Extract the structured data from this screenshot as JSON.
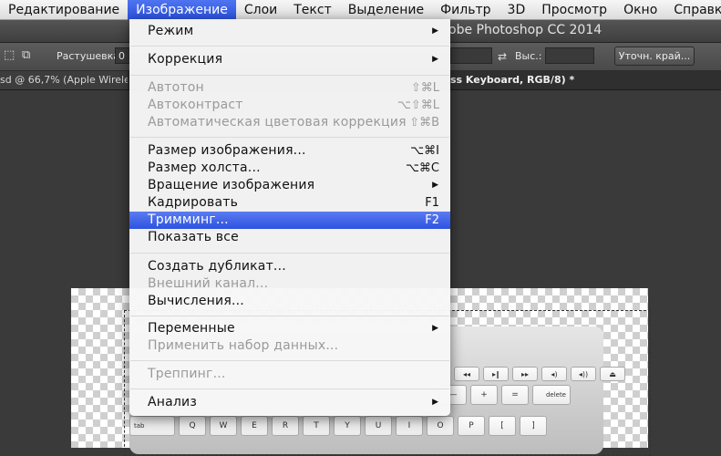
{
  "menubar": {
    "items": [
      "Редактирование",
      "Изображение",
      "Слои",
      "Текст",
      "Выделение",
      "Фильтр",
      "3D",
      "Просмотр",
      "Окно",
      "Справка"
    ]
  },
  "window": {
    "title": "obe Photoshop CC 2014"
  },
  "options_bar": {
    "feather_label": "Растушевка:",
    "feather_value": "0",
    "height_label": "Выс.:",
    "refine_edge_button": "Уточн. край..."
  },
  "tabs": [
    "sd @ 66,7% (Apple Wirele",
    "ss Keyboard, RGB/8) *"
  ],
  "keyboard": {
    "tab_key": "tab",
    "delete_key": "delete",
    "letter_keys": [
      "Q",
      "W",
      "E",
      "R",
      "T",
      "Y",
      "U",
      "I",
      "O",
      "P",
      "[",
      "]"
    ],
    "number_keys_right": [
      "-",
      "=",
      "delete"
    ]
  },
  "menu": {
    "items": [
      {
        "label": "Режим",
        "shortcut": "",
        "submenu": true,
        "disabled": false
      },
      {
        "label": "Коррекция",
        "shortcut": "",
        "submenu": true,
        "disabled": false
      },
      {
        "label": "Автотон",
        "shortcut": "⇧⌘L",
        "submenu": false,
        "disabled": true
      },
      {
        "label": "Автоконтраст",
        "shortcut": "⌥⇧⌘L",
        "submenu": false,
        "disabled": true
      },
      {
        "label": "Автоматическая цветовая коррекция",
        "shortcut": "⇧⌘B",
        "submenu": false,
        "disabled": true
      },
      {
        "label": "Размер изображения...",
        "shortcut": "⌥⌘I",
        "submenu": false,
        "disabled": false
      },
      {
        "label": "Размер холста...",
        "shortcut": "⌥⌘C",
        "submenu": false,
        "disabled": false
      },
      {
        "label": "Вращение изображения",
        "shortcut": "",
        "submenu": true,
        "disabled": false
      },
      {
        "label": "Кадрировать",
        "shortcut": "F1",
        "submenu": false,
        "disabled": false
      },
      {
        "label": "Тримминг...",
        "shortcut": "F2",
        "submenu": false,
        "disabled": false,
        "highlighted": true
      },
      {
        "label": "Показать все",
        "shortcut": "",
        "submenu": false,
        "disabled": false
      },
      {
        "label": "Создать дубликат...",
        "shortcut": "",
        "submenu": false,
        "disabled": false
      },
      {
        "label": "Внешний канал...",
        "shortcut": "",
        "submenu": false,
        "disabled": true
      },
      {
        "label": "Вычисления...",
        "shortcut": "",
        "submenu": false,
        "disabled": false
      },
      {
        "label": "Переменные",
        "shortcut": "",
        "submenu": true,
        "disabled": false
      },
      {
        "label": "Применить набор данных...",
        "shortcut": "",
        "submenu": false,
        "disabled": true
      },
      {
        "label": "Треппинг...",
        "shortcut": "",
        "submenu": false,
        "disabled": true
      },
      {
        "label": "Анализ",
        "shortcut": "",
        "submenu": true,
        "disabled": false
      }
    ]
  },
  "icons": {
    "submenu_arrow": "triangle-right-icon"
  },
  "colors": {
    "highlight": "#2e53df",
    "disabled_text": "#9a9a9a"
  }
}
